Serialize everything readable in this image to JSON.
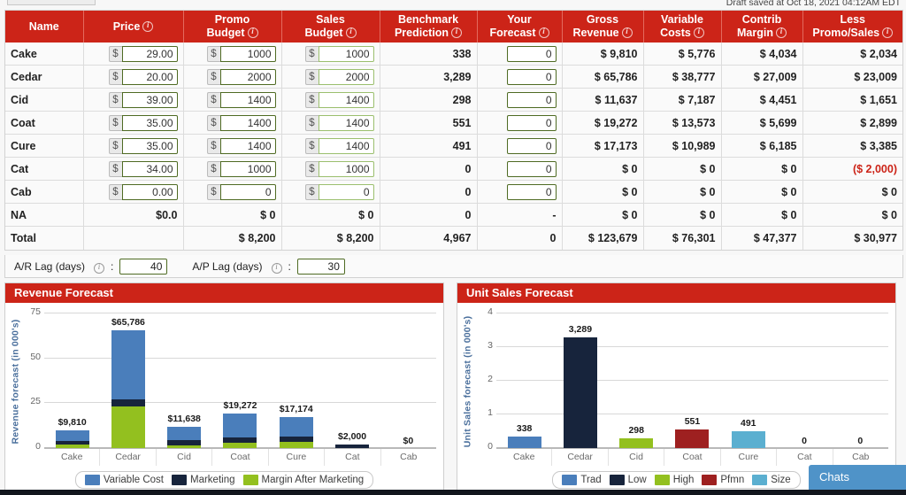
{
  "header_note": "Draft saved at Oct 18, 2021 04:12AM EDT",
  "columns": [
    {
      "label": "Name",
      "info": false
    },
    {
      "label": "Price",
      "info": true
    },
    {
      "label": "Promo\nBudget",
      "line1": "Promo",
      "line2": "Budget",
      "info": true
    },
    {
      "label": "Sales\nBudget",
      "line1": "Sales",
      "line2": "Budget",
      "info": true
    },
    {
      "label": "Benchmark\nPrediction",
      "line1": "Benchmark",
      "line2": "Prediction",
      "info": true
    },
    {
      "label": "Your\nForecast",
      "line1": "Your",
      "line2": "Forecast",
      "info": true
    },
    {
      "label": "Gross\nRevenue",
      "line1": "Gross",
      "line2": "Revenue",
      "info": true
    },
    {
      "label": "Variable\nCosts",
      "line1": "Variable",
      "line2": "Costs",
      "info": true
    },
    {
      "label": "Contrib\nMargin",
      "line1": "Contrib",
      "line2": "Margin",
      "info": true
    },
    {
      "label": "Less\nPromo/Sales",
      "line1": "Less",
      "line2": "Promo/Sales",
      "info": true
    }
  ],
  "rows": [
    {
      "name": "Cake",
      "price": "29.00",
      "promo": "1000",
      "sales": "1000",
      "benchmark": "338",
      "forecast": "0",
      "gross": "$ 9,810",
      "variable": "$ 5,776",
      "contrib": "$ 4,034",
      "less": "$ 2,034",
      "less_negative": false
    },
    {
      "name": "Cedar",
      "price": "20.00",
      "promo": "2000",
      "sales": "2000",
      "benchmark": "3,289",
      "forecast": "0",
      "gross": "$ 65,786",
      "variable": "$ 38,777",
      "contrib": "$ 27,009",
      "less": "$ 23,009",
      "less_negative": false
    },
    {
      "name": "Cid",
      "price": "39.00",
      "promo": "1400",
      "sales": "1400",
      "benchmark": "298",
      "forecast": "0",
      "gross": "$ 11,637",
      "variable": "$ 7,187",
      "contrib": "$ 4,451",
      "less": "$ 1,651",
      "less_negative": false
    },
    {
      "name": "Coat",
      "price": "35.00",
      "promo": "1400",
      "sales": "1400",
      "benchmark": "551",
      "forecast": "0",
      "gross": "$ 19,272",
      "variable": "$ 13,573",
      "contrib": "$ 5,699",
      "less": "$ 2,899",
      "less_negative": false
    },
    {
      "name": "Cure",
      "price": "35.00",
      "promo": "1400",
      "sales": "1400",
      "benchmark": "491",
      "forecast": "0",
      "gross": "$ 17,173",
      "variable": "$ 10,989",
      "contrib": "$ 6,185",
      "less": "$ 3,385",
      "less_negative": false
    },
    {
      "name": "Cat",
      "price": "34.00",
      "promo": "1000",
      "sales": "1000",
      "benchmark": "0",
      "forecast": "0",
      "gross": "$ 0",
      "variable": "$ 0",
      "contrib": "$ 0",
      "less": "($ 2,000)",
      "less_negative": true
    },
    {
      "name": "Cab",
      "price": "0.00",
      "promo": "0",
      "sales": "0",
      "benchmark": "0",
      "forecast": "0",
      "gross": "$ 0",
      "variable": "$ 0",
      "contrib": "$ 0",
      "less": "$ 0",
      "less_negative": false
    }
  ],
  "row_na": {
    "name": "NA",
    "price": "$0.0",
    "promo": "$ 0",
    "sales": "$ 0",
    "benchmark": "0",
    "forecast": "-",
    "gross": "$ 0",
    "variable": "$ 0",
    "contrib": "$ 0",
    "less": "$ 0"
  },
  "row_total": {
    "name": "Total",
    "price": "",
    "promo": "$ 8,200",
    "sales": "$ 8,200",
    "benchmark": "4,967",
    "forecast": "0",
    "gross": "$ 123,679",
    "variable": "$ 76,301",
    "contrib": "$ 47,377",
    "less": "$ 30,977"
  },
  "lag": {
    "ar_label": "A/R Lag (days)",
    "ar_sep": ":",
    "ar_value": "40",
    "ap_label": "A/P Lag (days)",
    "ap_sep": ":",
    "ap_value": "30"
  },
  "panels": {
    "revenue_title": "Revenue Forecast",
    "unit_title": "Unit Sales Forecast"
  },
  "chats": {
    "label": "Chats"
  },
  "colors": {
    "header_red": "#cc2418",
    "variable_cost": "#4a7ebb",
    "marketing": "#17243c",
    "margin_after_marketing": "#93c01f",
    "trad": "#4a7ebb",
    "low": "#17243c",
    "high": "#93c01f",
    "pfmn": "#9e2020",
    "size": "#5bafd0",
    "negative": "#cc2418",
    "chats_blue": "#4f93c8"
  },
  "chart_data": [
    {
      "type": "bar",
      "stacked": true,
      "title": "Revenue Forecast",
      "xlabel": "",
      "ylabel": "Revenue forecast (in 000's)",
      "ylim": [
        0,
        75
      ],
      "yticks": [
        0,
        25,
        50,
        75
      ],
      "grid": true,
      "legend_position": "bottom",
      "categories": [
        "Cake",
        "Cedar",
        "Cid",
        "Coat",
        "Cure",
        "Cat",
        "Cab"
      ],
      "data_labels": [
        "$9,810",
        "$65,786",
        "$11,638",
        "$19,272",
        "$17,174",
        "$2,000",
        "$0"
      ],
      "totals": [
        9.81,
        65.786,
        11.638,
        19.272,
        17.174,
        2.0,
        0
      ],
      "series": [
        {
          "name": "Margin After Marketing",
          "color": "#93c01f",
          "values": [
            2.034,
            23.009,
            1.651,
            2.899,
            3.385,
            0,
            0
          ]
        },
        {
          "name": "Marketing",
          "color": "#17243c",
          "values": [
            2.0,
            4.0,
            2.8,
            2.8,
            2.8,
            2.0,
            0
          ]
        },
        {
          "name": "Variable Cost",
          "color": "#4a7ebb",
          "values": [
            5.776,
            38.777,
            7.187,
            13.573,
            10.989,
            0,
            0
          ]
        }
      ],
      "legend": [
        "Variable Cost",
        "Marketing",
        "Margin After Marketing"
      ]
    },
    {
      "type": "bar",
      "stacked": false,
      "title": "Unit Sales Forecast",
      "xlabel": "",
      "ylabel": "Unit Sales forecast (in 000's)",
      "ylim": [
        0,
        4
      ],
      "yticks": [
        0,
        1,
        2,
        3,
        4
      ],
      "grid": true,
      "legend_position": "bottom",
      "categories": [
        "Cake",
        "Cedar",
        "Cid",
        "Coat",
        "Cure",
        "Cat",
        "Cab"
      ],
      "data_labels": [
        "338",
        "3,289",
        "298",
        "551",
        "491",
        "0",
        "0"
      ],
      "values": [
        0.338,
        3.289,
        0.298,
        0.551,
        0.491,
        0,
        0
      ],
      "bar_colors": [
        "#4a7ebb",
        "#17243c",
        "#93c01f",
        "#9e2020",
        "#5bafd0",
        "#4a7ebb",
        "#17243c"
      ],
      "legend": [
        "Trad",
        "Low",
        "High",
        "Pfmn",
        "Size"
      ],
      "legend_colors": [
        "#4a7ebb",
        "#17243c",
        "#93c01f",
        "#9e2020",
        "#5bafd0"
      ]
    }
  ]
}
